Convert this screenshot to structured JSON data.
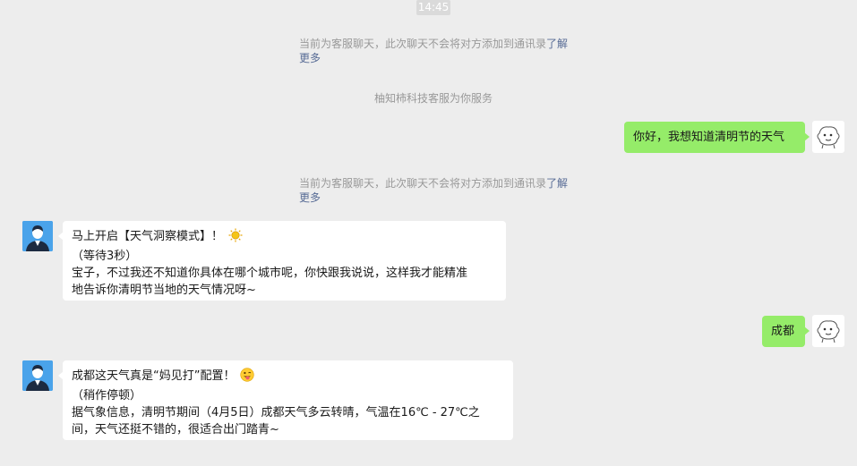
{
  "timestamp": "14:45",
  "notice1": {
    "text": "当前为客服聊天，此次聊天不会将对方添加到通讯录",
    "link_a": "了解",
    "link_b": "更多"
  },
  "service_notice": "柚知柿科技客服为你服务",
  "notice2": {
    "text": "当前为客服聊天，此次聊天不会将对方添加到通讯录",
    "link_a": "了解",
    "link_b": "更多"
  },
  "messages": [
    {
      "from": "user",
      "text": "你好，我想知道清明节的天气"
    },
    {
      "from": "bot",
      "line1": "马上开启【天气洞察模式】！",
      "line1_icon": "sun-icon",
      "line2": "（等待3秒）",
      "line3": "宝子，不过我还不知道你具体在哪个城市呢，你快跟我说说，这样我才能精准",
      "line4": "地告诉你清明节当地的天气情况呀~"
    },
    {
      "from": "user",
      "text": "成都"
    },
    {
      "from": "bot",
      "line1": "成都这天气真是“妈见打”配置！",
      "line1_icon": "tongue-face-icon",
      "line2": "（稍作停顿）",
      "line3": "据气象信息，清明节期间（4月5日）成都天气多云转晴，气温在16℃ - 27℃之",
      "line4": "间，天气还挺不错的，很适合出门踏青~"
    }
  ],
  "colors": {
    "background": "#ededed",
    "user_bubble": "#95ec69",
    "bot_bubble": "#ffffff",
    "link": "#576b95",
    "bot_avatar": "#4aa3ea"
  }
}
